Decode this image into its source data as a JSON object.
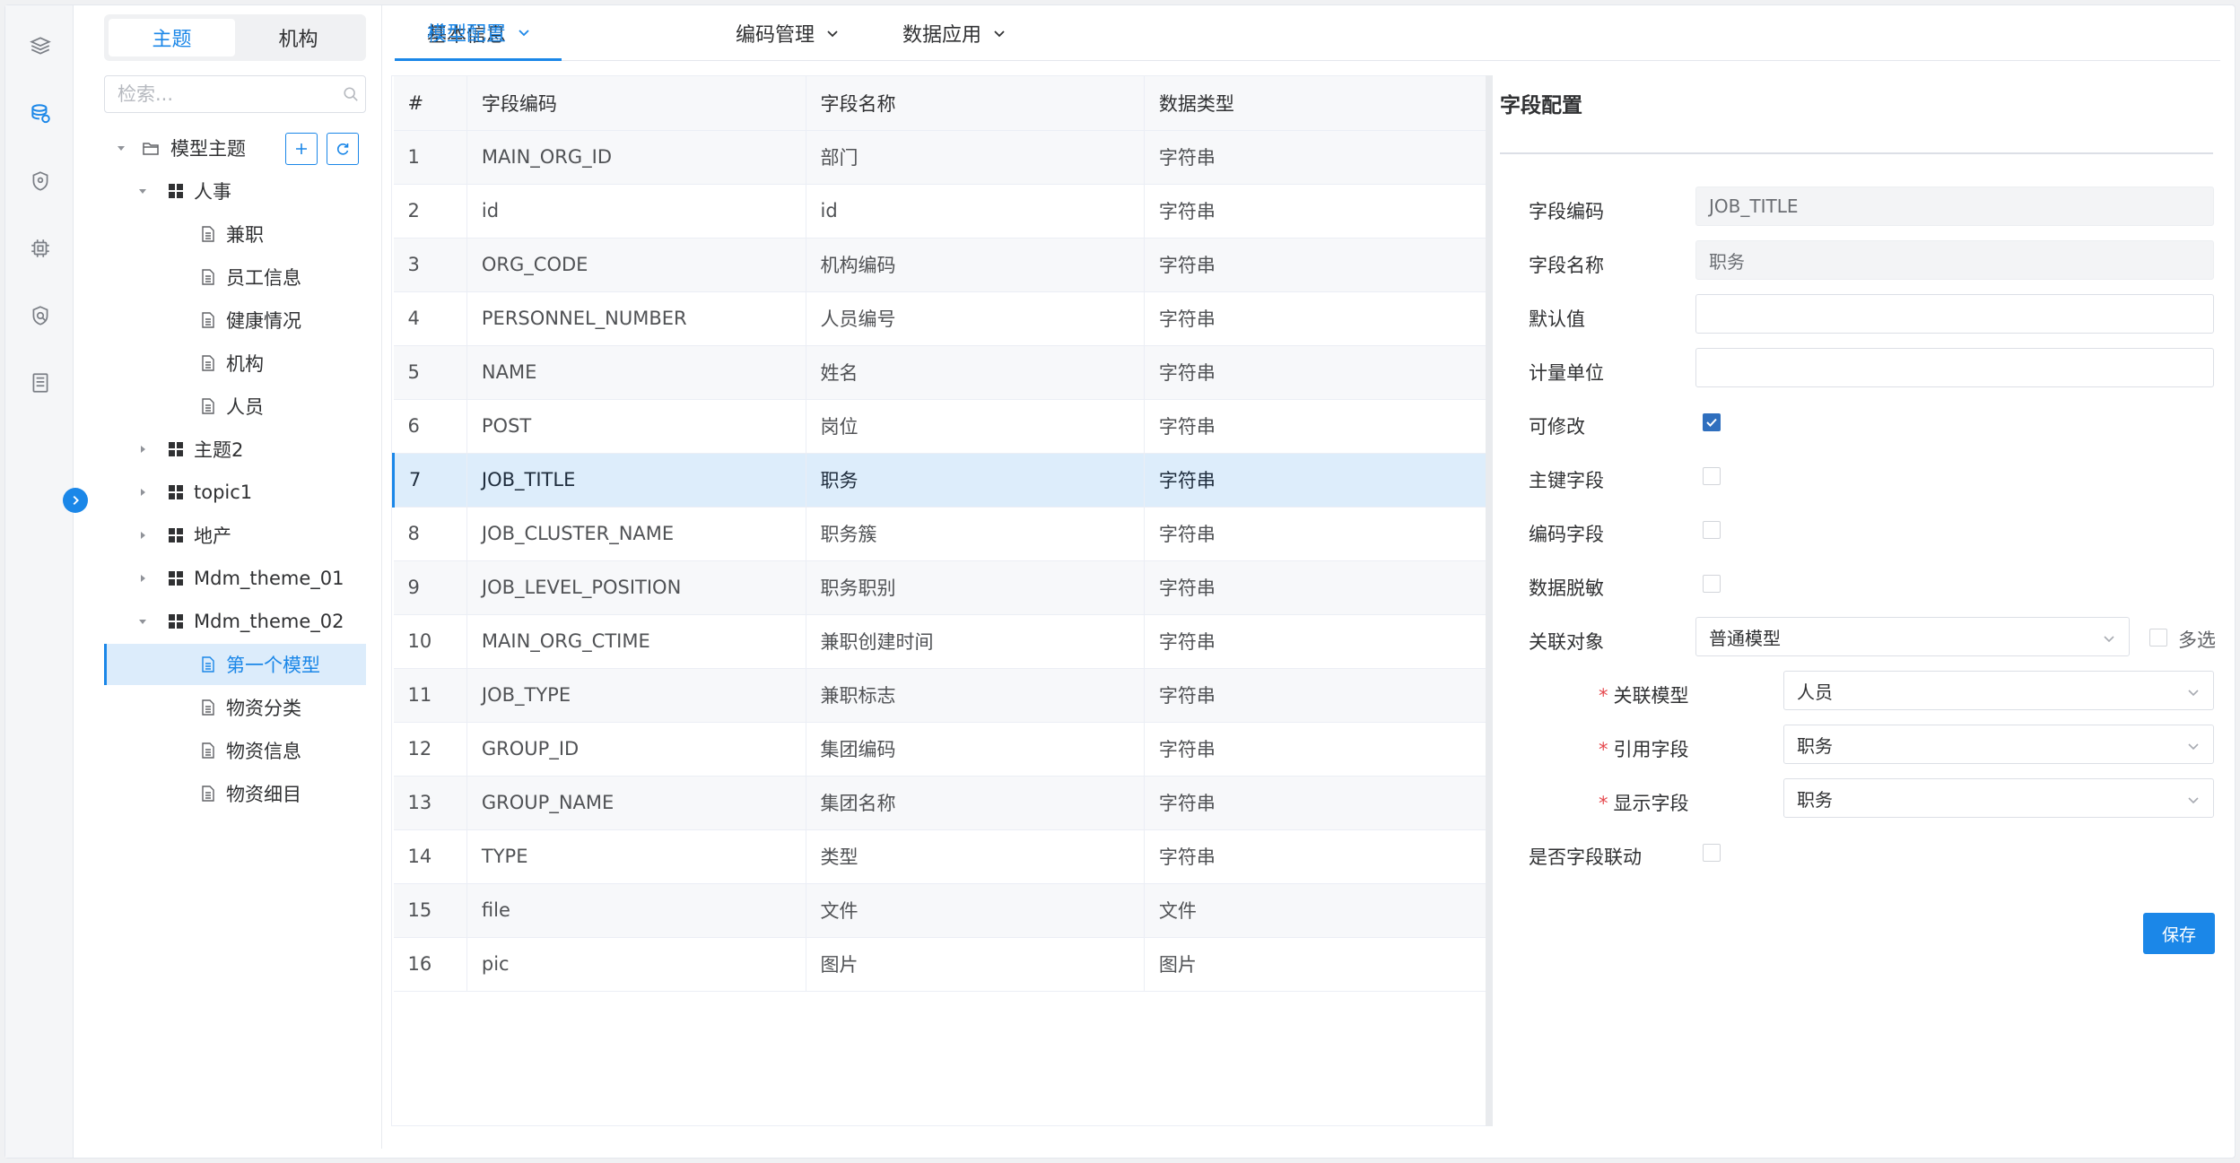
{
  "rail": {
    "icons": [
      "layers-icon",
      "database-icon",
      "shield-icon",
      "chip-icon",
      "security-icon",
      "document-icon"
    ]
  },
  "tree": {
    "segments": [
      "主题",
      "机构"
    ],
    "search_placeholder": "检索...",
    "root_label": "模型主题",
    "nodes": [
      {
        "label": "人事",
        "type": "group",
        "expanded": true
      },
      {
        "label": "兼职",
        "type": "doc"
      },
      {
        "label": "员工信息",
        "type": "doc"
      },
      {
        "label": "健康情况",
        "type": "doc"
      },
      {
        "label": "机构",
        "type": "doc"
      },
      {
        "label": "人员",
        "type": "doc"
      },
      {
        "label": "主题2",
        "type": "group",
        "expanded": false
      },
      {
        "label": "topic1",
        "type": "group",
        "expanded": false
      },
      {
        "label": "地产",
        "type": "group",
        "expanded": false
      },
      {
        "label": "Mdm_theme_01",
        "type": "group",
        "expanded": false
      },
      {
        "label": "Mdm_theme_02",
        "type": "group",
        "expanded": true
      },
      {
        "label": "第一个模型",
        "type": "doc",
        "selected": true
      },
      {
        "label": "物资分类",
        "type": "doc"
      },
      {
        "label": "物资信息",
        "type": "doc"
      },
      {
        "label": "物资细目",
        "type": "doc"
      }
    ]
  },
  "tabs": [
    {
      "label": "基本信息",
      "dropdown": false,
      "active": false
    },
    {
      "label": "模型配置",
      "dropdown": true,
      "active": true
    },
    {
      "label": "编码管理",
      "dropdown": true,
      "active": false
    },
    {
      "label": "数据应用",
      "dropdown": true,
      "active": false
    }
  ],
  "table": {
    "headers": [
      "#",
      "字段编码",
      "字段名称",
      "数据类型"
    ],
    "rows": [
      [
        "1",
        "MAIN_ORG_ID",
        "部门",
        "字符串"
      ],
      [
        "2",
        "id",
        "id",
        "字符串"
      ],
      [
        "3",
        "ORG_CODE",
        "机构编码",
        "字符串"
      ],
      [
        "4",
        "PERSONNEL_NUMBER",
        "人员编号",
        "字符串"
      ],
      [
        "5",
        "NAME",
        "姓名",
        "字符串"
      ],
      [
        "6",
        "POST",
        "岗位",
        "字符串"
      ],
      [
        "7",
        "JOB_TITLE",
        "职务",
        "字符串"
      ],
      [
        "8",
        "JOB_CLUSTER_NAME",
        "职务簇",
        "字符串"
      ],
      [
        "9",
        "JOB_LEVEL_POSITION",
        "职务职别",
        "字符串"
      ],
      [
        "10",
        "MAIN_ORG_CTIME",
        "兼职创建时间",
        "字符串"
      ],
      [
        "11",
        "JOB_TYPE",
        "兼职标志",
        "字符串"
      ],
      [
        "12",
        "GROUP_ID",
        "集团编码",
        "字符串"
      ],
      [
        "13",
        "GROUP_NAME",
        "集团名称",
        "字符串"
      ],
      [
        "14",
        "TYPE",
        "类型",
        "字符串"
      ],
      [
        "15",
        "file",
        "文件",
        "文件"
      ],
      [
        "16",
        "pic",
        "图片",
        "图片"
      ]
    ],
    "selected_row": 7
  },
  "form": {
    "title": "字段配置",
    "field_code_label": "字段编码",
    "field_code_value": "JOB_TITLE",
    "field_name_label": "字段名称",
    "field_name_value": "职务",
    "default_label": "默认值",
    "default_value": "",
    "unit_label": "计量单位",
    "unit_value": "",
    "editable_label": "可修改",
    "editable": true,
    "pk_label": "主键字段",
    "pk": false,
    "code_label": "编码字段",
    "code": false,
    "mask_label": "数据脱敏",
    "mask": false,
    "relation_label": "关联对象",
    "relation_value": "普通模型",
    "multi_label": "多选",
    "multi": false,
    "rel_model_label": "关联模型",
    "rel_model_value": "人员",
    "ref_field_label": "引用字段",
    "ref_field_value": "职务",
    "display_field_label": "显示字段",
    "display_field_value": "职务",
    "linkage_label": "是否字段联动",
    "linkage": false,
    "save_label": "保存"
  },
  "colors": {
    "accent": "#1b87e8",
    "selected_row": "#ddedfb",
    "required": "#e5484d"
  }
}
